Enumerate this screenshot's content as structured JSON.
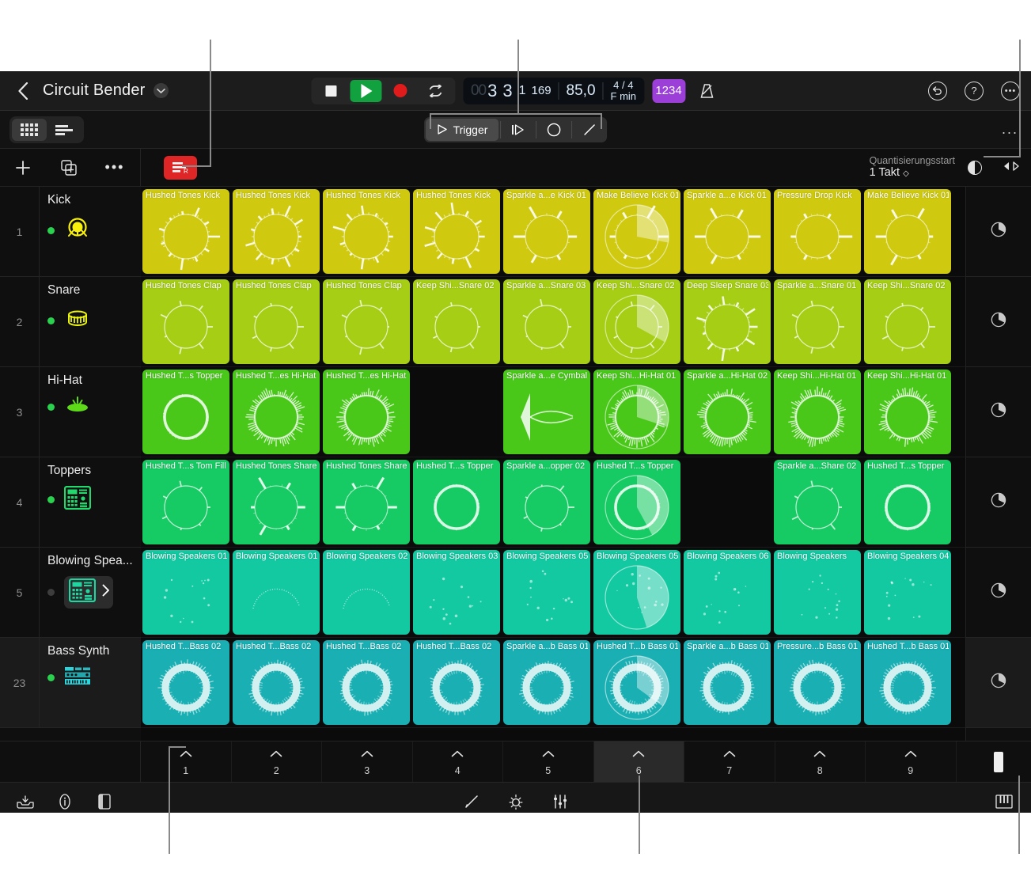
{
  "topbar": {
    "back_icon": "chevron-left-icon",
    "project_title": "Circuit Bender",
    "caret_icon": "chevron-down-icon",
    "stop_label": "Stop",
    "play_label": "Play",
    "record_label": "Record",
    "cycle_label": "Cycle",
    "lcd": {
      "bars_dim": "00",
      "bars": "3",
      "beats": "3",
      "divisions": "1",
      "ticks": "169",
      "tempo": "85,0",
      "time_signature": "4 / 4",
      "key": "F min"
    },
    "count_in_label": "1234",
    "metronome_label": "Metronome",
    "undo_icon": "undo-icon",
    "help_icon": "help-icon",
    "more_icon": "more-circle-icon"
  },
  "viewrow": {
    "grid_view_label": "Cell Grid View",
    "list_view_label": "Track List View",
    "mode": {
      "trigger_label": "Trigger",
      "play_icon": "play-outline-icon",
      "step_icon": "step-play-icon",
      "circle_icon": "circle-icon",
      "line_icon": "line-icon"
    },
    "overflow_label": "..."
  },
  "toolrow": {
    "add_label": "+",
    "duplicate_label": "Duplicate",
    "more_label": "...",
    "record_enable_label": "R",
    "quantize_start_label": "Quantisierungsstart",
    "quantize_start_value": "1 Takt",
    "contrast_icon": "half-circle-icon",
    "pan_icon": "pan-arrows-icon"
  },
  "tracks": [
    {
      "num": "1",
      "name": "Kick",
      "led": "on",
      "icon": "kick-drum-icon",
      "icon_color": "#f7f00d",
      "boxed": false,
      "selected": false
    },
    {
      "num": "2",
      "name": "Snare",
      "led": "on",
      "icon": "snare-drum-icon",
      "icon_color": "#eaf40b",
      "boxed": false,
      "selected": false
    },
    {
      "num": "3",
      "name": "Hi-Hat",
      "led": "on",
      "icon": "hihat-icon",
      "icon_color": "#5ddb18",
      "boxed": false,
      "selected": false
    },
    {
      "num": "4",
      "name": "Toppers",
      "led": "on",
      "icon": "sampler-icon",
      "icon_color": "#23d96e",
      "boxed": false,
      "selected": false
    },
    {
      "num": "5",
      "name": "Blowing Spea...",
      "led": "off",
      "icon": "sampler-icon",
      "icon_color": "#1fd6a0",
      "boxed": true,
      "selected": false
    },
    {
      "num": "23",
      "name": "Bass Synth",
      "led": "on",
      "icon": "synth-keys-icon",
      "icon_color": "#2ad4dd",
      "boxed": false,
      "selected": true
    }
  ],
  "grid": {
    "row_colors": [
      "#cfca10",
      "#a6ce14",
      "#49c81a",
      "#16cb63",
      "#13c9a2",
      "#19afb3"
    ],
    "rows": [
      {
        "track": "Kick",
        "cells": [
          {
            "label": "Hushed Tones Kick",
            "wave": "burst",
            "progress": 0
          },
          {
            "label": "Hushed Tones Kick",
            "wave": "burst",
            "progress": 0
          },
          {
            "label": "Hushed Tones Kick",
            "wave": "burst",
            "progress": 0
          },
          {
            "label": "Hushed Tones Kick",
            "wave": "burst",
            "progress": 0
          },
          {
            "label": "Sparkle a...e Kick 01",
            "wave": "spike",
            "progress": 0
          },
          {
            "label": "Make Believe Kick 01",
            "wave": "spike",
            "progress": 0.28
          },
          {
            "label": "Sparkle a...e Kick 01",
            "wave": "spike",
            "progress": 0
          },
          {
            "label": "Pressure Drop Kick",
            "wave": "spike",
            "progress": 0
          },
          {
            "label": "Make Believe Kick 01",
            "wave": "spike",
            "progress": 0
          }
        ]
      },
      {
        "track": "Snare",
        "cells": [
          {
            "label": "Hushed Tones Clap",
            "wave": "thin",
            "progress": 0
          },
          {
            "label": "Hushed Tones Clap",
            "wave": "thin",
            "progress": 0
          },
          {
            "label": "Hushed Tones Clap",
            "wave": "thin",
            "progress": 0
          },
          {
            "label": "Keep Shi...Snare 02",
            "wave": "thin",
            "progress": 0
          },
          {
            "label": "Sparkle a...Snare 03",
            "wave": "thin",
            "progress": 0
          },
          {
            "label": "Keep Shi...Snare 02",
            "wave": "thin",
            "progress": 0.33
          },
          {
            "label": "Deep Sleep Snare 03",
            "wave": "burst",
            "progress": 0
          },
          {
            "label": "Sparkle a...Snare 01",
            "wave": "thin",
            "progress": 0
          },
          {
            "label": "Keep Shi...Snare 02",
            "wave": "thin",
            "progress": 0
          }
        ]
      },
      {
        "track": "Hi-Hat",
        "cells": [
          {
            "label": "Hushed T...s Topper",
            "wave": "ring",
            "progress": 0
          },
          {
            "label": "Hushed T...es Hi-Hat",
            "wave": "dense",
            "progress": 0
          },
          {
            "label": "Hushed T...es Hi-Hat",
            "wave": "dense",
            "progress": 0
          },
          {
            "label": "",
            "wave": "empty",
            "progress": 0
          },
          {
            "label": "Sparkle a...e Cymbal",
            "wave": "decay",
            "progress": 0
          },
          {
            "label": "Keep Shi...Hi-Hat 01",
            "wave": "dense",
            "progress": 0.3
          },
          {
            "label": "Sparkle a...Hi-Hat 02",
            "wave": "dense",
            "progress": 0
          },
          {
            "label": "Keep Shi...Hi-Hat 01",
            "wave": "dense",
            "progress": 0
          },
          {
            "label": "Keep Shi...Hi-Hat 01",
            "wave": "dense",
            "progress": 0
          }
        ]
      },
      {
        "track": "Toppers",
        "cells": [
          {
            "label": "Hushed T...s Tom Fill",
            "wave": "thin",
            "progress": 0
          },
          {
            "label": "Hushed Tones Share",
            "wave": "spike",
            "progress": 0
          },
          {
            "label": "Hushed Tones Share",
            "wave": "spike",
            "progress": 0
          },
          {
            "label": "Hushed T...s Topper",
            "wave": "ring",
            "progress": 0
          },
          {
            "label": "Sparkle a...opper 02",
            "wave": "thin",
            "progress": 0
          },
          {
            "label": "Hushed T...s Topper",
            "wave": "ring",
            "progress": 0.42
          },
          {
            "label": "",
            "wave": "empty",
            "progress": 0
          },
          {
            "label": "Sparkle a...Share 02",
            "wave": "thin",
            "progress": 0
          },
          {
            "label": "Hushed T...s Topper",
            "wave": "ring",
            "progress": 0
          }
        ]
      },
      {
        "track": "Blowing Spea...",
        "cells": [
          {
            "label": "Blowing Speakers 01",
            "wave": "sparse",
            "progress": 0
          },
          {
            "label": "Blowing Speakers 01",
            "wave": "arc",
            "progress": 0
          },
          {
            "label": "Blowing Speakers 02",
            "wave": "arc",
            "progress": 0
          },
          {
            "label": "Blowing Speakers 03",
            "wave": "sparse",
            "progress": 0
          },
          {
            "label": "Blowing Speakers 05",
            "wave": "sparse",
            "progress": 0
          },
          {
            "label": "Blowing Speakers 05",
            "wave": "sparse",
            "progress": 0.45
          },
          {
            "label": "Blowing Speakers 06",
            "wave": "sparse",
            "progress": 0
          },
          {
            "label": "Blowing Speakers",
            "wave": "sparse",
            "progress": 0
          },
          {
            "label": "Blowing Speakers 04",
            "wave": "sparse",
            "progress": 0
          }
        ]
      },
      {
        "track": "Bass Synth",
        "cells": [
          {
            "label": "Hushed T...Bass 02",
            "wave": "ringthick",
            "progress": 0
          },
          {
            "label": "Hushed T...Bass 02",
            "wave": "ringthick",
            "progress": 0
          },
          {
            "label": "Hushed T...Bass 02",
            "wave": "ringthick",
            "progress": 0
          },
          {
            "label": "Hushed T...Bass 02",
            "wave": "ringthick",
            "progress": 0
          },
          {
            "label": "Sparkle a...b Bass 01",
            "wave": "ringthick",
            "progress": 0
          },
          {
            "label": "Hushed T...b Bass 01",
            "wave": "ringthick",
            "progress": 0.35
          },
          {
            "label": "Sparkle a...b Bass 01",
            "wave": "ringthick",
            "progress": 0
          },
          {
            "label": "Pressure...b Bass 01",
            "wave": "ringthick",
            "progress": 0
          },
          {
            "label": "Hushed T...b Bass 01",
            "wave": "ringthick",
            "progress": 0
          }
        ]
      }
    ]
  },
  "scenes": {
    "items": [
      "1",
      "2",
      "3",
      "4",
      "5",
      "6",
      "7",
      "8",
      "9"
    ],
    "active": "6",
    "play_icon": "chevron-up-icon"
  },
  "bottombar": {
    "library_icon": "library-icon",
    "info_icon": "info-icon",
    "panel_icon": "panel-icon",
    "pencil_icon": "pencil-icon",
    "tune_icon": "tuner-icon",
    "mixer_icon": "faders-icon",
    "keyboard_icon": "piano-keys-icon"
  }
}
